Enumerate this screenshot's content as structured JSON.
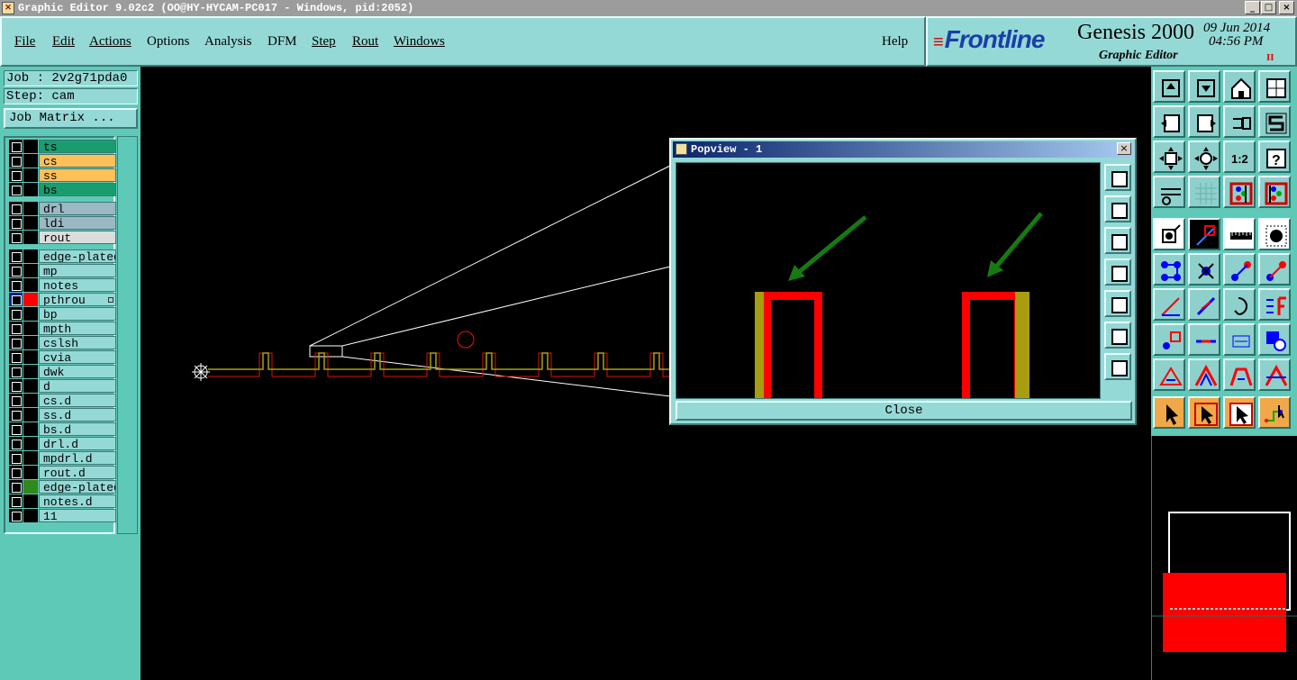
{
  "window": {
    "title": "Graphic Editor 9.02c2  (OO@HY-HYCAM-PC017 - Windows, pid:2052)",
    "controls": [
      "_",
      "□",
      "×"
    ]
  },
  "menu": {
    "items": [
      "File",
      "Edit",
      "Actions",
      "Options",
      "Analysis",
      "DFM",
      "Step",
      "Rout",
      "Windows"
    ],
    "help": "Help"
  },
  "brand": {
    "logo": "Frontline",
    "product": "Genesis 2000",
    "subtitle": "Graphic Editor",
    "date": "09 Jun 2014",
    "time": "04:56 PM",
    "pause": "II"
  },
  "job": {
    "job_label": "Job : 2v2g71pda0",
    "step_label": "Step: cam",
    "matrix_button": "Job Matrix ..."
  },
  "layers": [
    {
      "name": "ts",
      "bg": "#1a9c6e",
      "swatch": "#000"
    },
    {
      "name": "cs",
      "bg": "#ffc05a",
      "swatch": "#000"
    },
    {
      "name": "ss",
      "bg": "#ffc05a",
      "swatch": "#000"
    },
    {
      "name": "bs",
      "bg": "#1a9c6e",
      "swatch": "#000"
    },
    {
      "name": "drl",
      "bg": "#9cb8c4",
      "swatch": "#000"
    },
    {
      "name": "ldi",
      "bg": "#9cb8c4",
      "swatch": "#000"
    },
    {
      "name": "rout",
      "bg": "#dcdcdc",
      "swatch": "#000"
    },
    {
      "name": "edge-plated",
      "bg": "#95d9d6",
      "swatch": "#000"
    },
    {
      "name": "mp",
      "bg": "#95d9d6",
      "swatch": "#000"
    },
    {
      "name": "notes",
      "bg": "#95d9d6",
      "swatch": "#000"
    },
    {
      "name": "pthrou",
      "bg": "#95d9d6",
      "swatch": "#ff0000",
      "affected": true
    },
    {
      "name": "bp",
      "bg": "#95d9d6",
      "swatch": "#000"
    },
    {
      "name": "mpth",
      "bg": "#95d9d6",
      "swatch": "#000"
    },
    {
      "name": "cslsh",
      "bg": "#95d9d6",
      "swatch": "#000"
    },
    {
      "name": "cvia",
      "bg": "#95d9d6",
      "swatch": "#000"
    },
    {
      "name": "dwk",
      "bg": "#95d9d6",
      "swatch": "#000"
    },
    {
      "name": "d",
      "bg": "#95d9d6",
      "swatch": "#000"
    },
    {
      "name": "cs.d",
      "bg": "#95d9d6",
      "swatch": "#000"
    },
    {
      "name": "ss.d",
      "bg": "#95d9d6",
      "swatch": "#000"
    },
    {
      "name": "bs.d",
      "bg": "#95d9d6",
      "swatch": "#000"
    },
    {
      "name": "drl.d",
      "bg": "#95d9d6",
      "swatch": "#000"
    },
    {
      "name": "mpdrl.d",
      "bg": "#95d9d6",
      "swatch": "#000"
    },
    {
      "name": "rout.d",
      "bg": "#95d9d6",
      "swatch": "#000"
    },
    {
      "name": "edge-plated",
      "bg": "#95d9d6",
      "swatch": "#2e8a1a"
    },
    {
      "name": "notes.d",
      "bg": "#95d9d6",
      "swatch": "#000"
    },
    {
      "name": "11",
      "bg": "#95d9d6",
      "swatch": "#000"
    }
  ],
  "popview": {
    "title": "Popview - 1",
    "close_label": "Close"
  },
  "toolbar_icons": [
    "layer-up-icon",
    "layer-down-icon",
    "home-icon",
    "window-split-icon",
    "pan-left-icon",
    "pan-right-icon",
    "undo-view-icon",
    "redraw-icon",
    "zoom-fit-icon",
    "zoom-center-icon",
    "scale-1to2-icon",
    "help-icon",
    "measure-tools-icon",
    "grid-icon",
    "color-layers-icon",
    "color-layers-alt-icon",
    "select-pad-icon",
    "line-tool-icon",
    "ruler-icon",
    "record-icon",
    "net-icon",
    "delete-node-icon",
    "add-point-icon",
    "move-point-icon",
    "angle-icon",
    "draw-line-icon",
    "rotate-icon",
    "mirror-icon",
    "connect-icon",
    "distance-icon",
    "box-measure-icon",
    "pads-icon",
    "triangle-icon",
    "triangle-outline-icon",
    "arch-icon",
    "arch-select-icon",
    "pointer-icon",
    "pointer-box-icon",
    "pointer-alt-icon",
    "pointer-route-icon"
  ],
  "colors": {
    "panel": "#95d9d6",
    "panel_dark": "#5fc9b8",
    "feature_red": "#ff0000",
    "feature_olive": "#a89c10",
    "arrow_green": "#157a10"
  }
}
